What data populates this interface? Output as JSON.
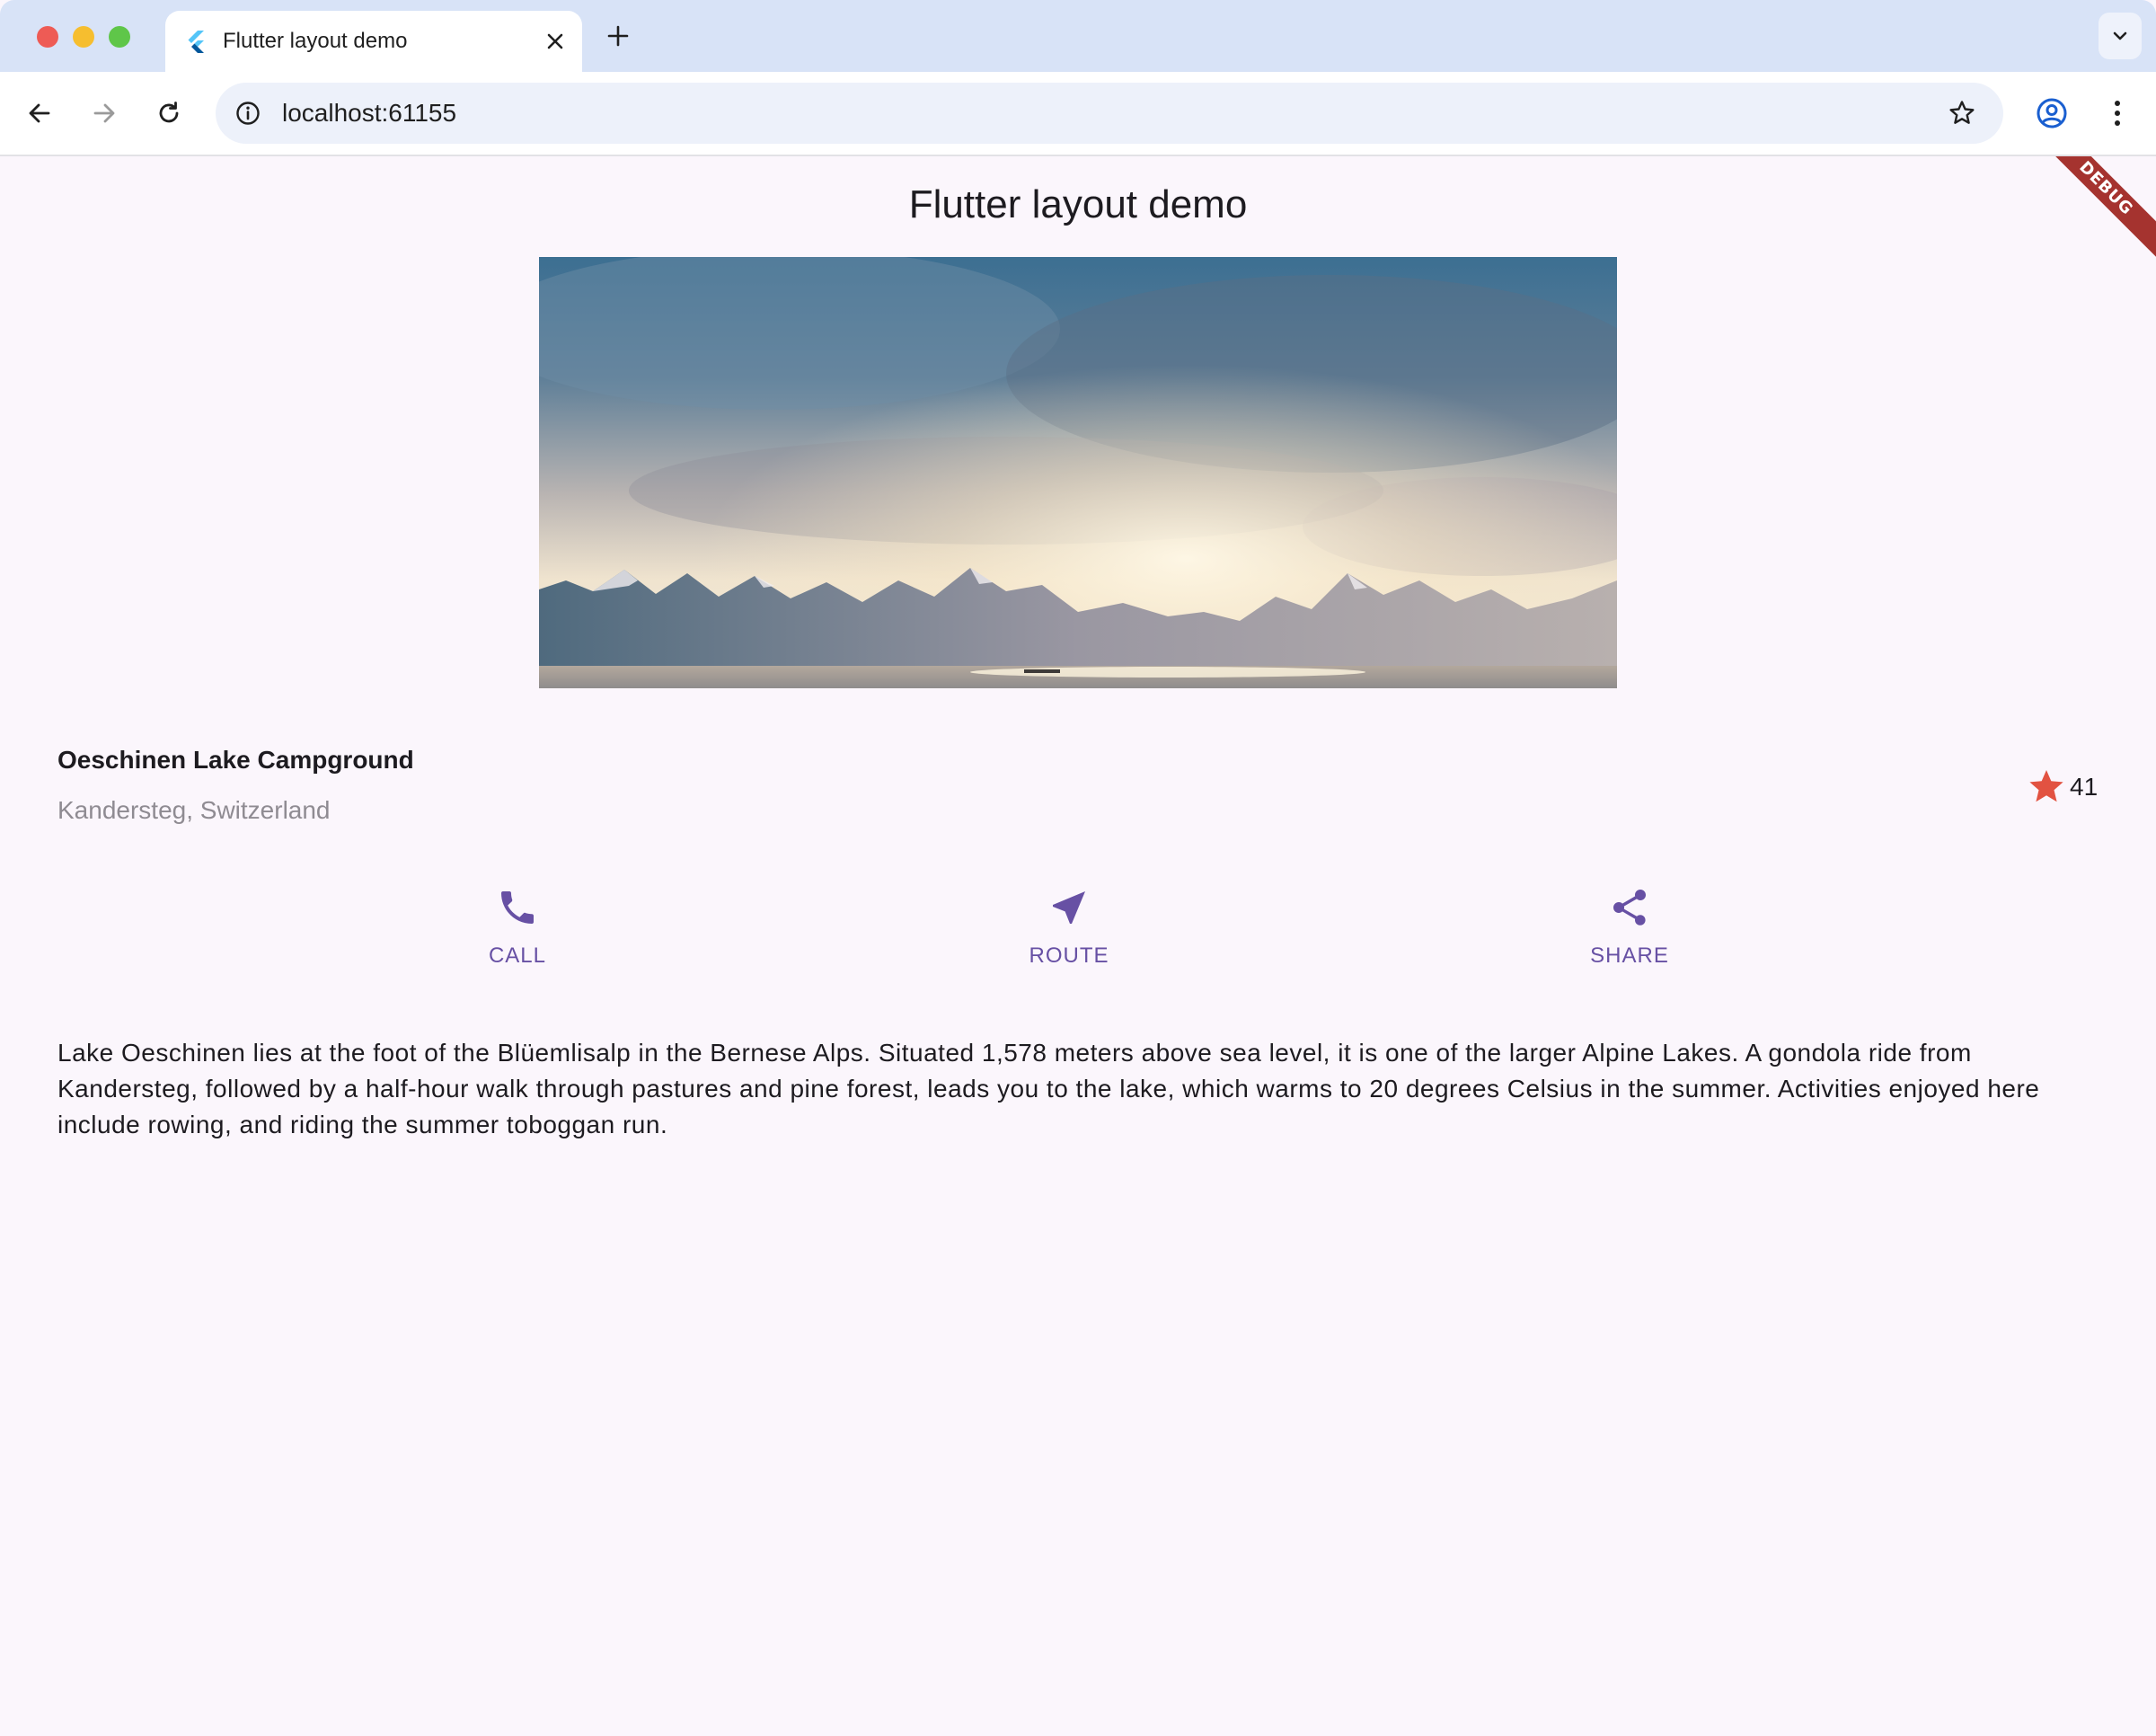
{
  "browser": {
    "tab_title": "Flutter layout demo",
    "url": "localhost:61155",
    "close_glyph": "✕",
    "new_tab_glyph": "+"
  },
  "app": {
    "title": "Flutter layout demo",
    "debug_banner": "DEBUG"
  },
  "place": {
    "name": "Oeschinen Lake Campground",
    "location": "Kandersteg, Switzerland",
    "rating_count": "41",
    "rating_icon": "star-icon",
    "rating_color": "#e25241"
  },
  "actions": [
    {
      "label": "CALL",
      "icon": "phone-icon"
    },
    {
      "label": "ROUTE",
      "icon": "navigation-icon"
    },
    {
      "label": "SHARE",
      "icon": "share-icon"
    }
  ],
  "accent_color": "#6750a4",
  "description": "Lake Oeschinen lies at the foot of the Blüemlisalp in the Bernese Alps. Situated 1,578 meters above sea level, it is one of the larger Alpine Lakes. A gondola ride from Kandersteg, followed by a half-hour walk through pastures and pine forest, leads you to the lake, which warms to 20 degrees Celsius in the summer. Activities enjoyed here include rowing, and riding the summer toboggan run."
}
